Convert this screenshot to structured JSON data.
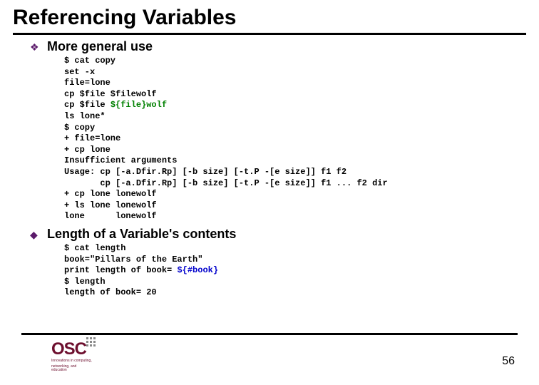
{
  "title": "Referencing Variables",
  "sections": [
    {
      "bullet_glyph": "❖",
      "heading": "More general use"
    },
    {
      "bullet_glyph": "◆",
      "heading": "Length of a Variable's contents"
    }
  ],
  "code1": {
    "l0": "$ cat copy",
    "l1": "set -x",
    "l2": "file=lone",
    "l3": "cp $file $filewolf",
    "l4_a": "cp $file ",
    "l4_b": "${file}wolf",
    "l5": "ls lone*",
    "l6": "$ copy",
    "l7": "+ file=lone",
    "l8": "+ cp lone",
    "l9": "Insufficient arguments",
    "l10": "Usage: cp [-a.Dfir.Rp] [-b size] [-t.P -[e size]] f1 f2",
    "l11": "       cp [-a.Dfir.Rp] [-b size] [-t.P -[e size]] f1 ... f2 dir",
    "l12": "+ cp lone lonewolf",
    "l13": "+ ls lone lonewolf",
    "l14": "lone      lonewolf"
  },
  "code2": {
    "l0": "$ cat length",
    "l1": "book=\"Pillars of the Earth\"",
    "l2_a": "print length of book= ",
    "l2_b": "${#book}",
    "l3": "$ length",
    "l4": "length of book= 20"
  },
  "logo": {
    "text": "OSC",
    "tag1": "Innovations in computing,",
    "tag2": "networking, and education"
  },
  "page_number": "56"
}
